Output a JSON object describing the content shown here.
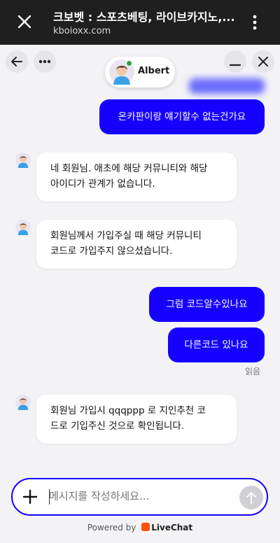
{
  "browser": {
    "title": "크보벳 : 스포츠베팅, 라이브카지노,...",
    "url": "kboioxx.com"
  },
  "agent": {
    "name": "Albert",
    "status_color": "#2ea043"
  },
  "messages": [
    {
      "from": "visitor",
      "text": "온카판이랑 얘기할수 없는건가요"
    },
    {
      "from": "agent",
      "lines": [
        "네 회원님. 애초에 해당 커뮤니티와 해당",
        "아이디가 관계가 없습니다."
      ]
    },
    {
      "from": "agent",
      "lines": [
        "회원님께서 가입주실 때 해당 커뮤니티",
        "코드로 가입주지 않으셨습니다."
      ]
    },
    {
      "from": "visitor",
      "text": "그럼 코드알수있나요"
    },
    {
      "from": "visitor",
      "text": "다른코드 있나요"
    },
    {
      "from": "agent",
      "lines": [
        "회원님 가입시 qqqppp 로 지인추천 코",
        "드로 기입주신 것으로 확인됩니다."
      ]
    }
  ],
  "read_status": "읽음",
  "composer": {
    "placeholder": "메시지를 작성하세요..."
  },
  "footer": {
    "powered_by": "Powered by",
    "brand": "LiveChat"
  },
  "colors": {
    "accent": "#1600ff",
    "brand_orange": "#ff5100"
  }
}
